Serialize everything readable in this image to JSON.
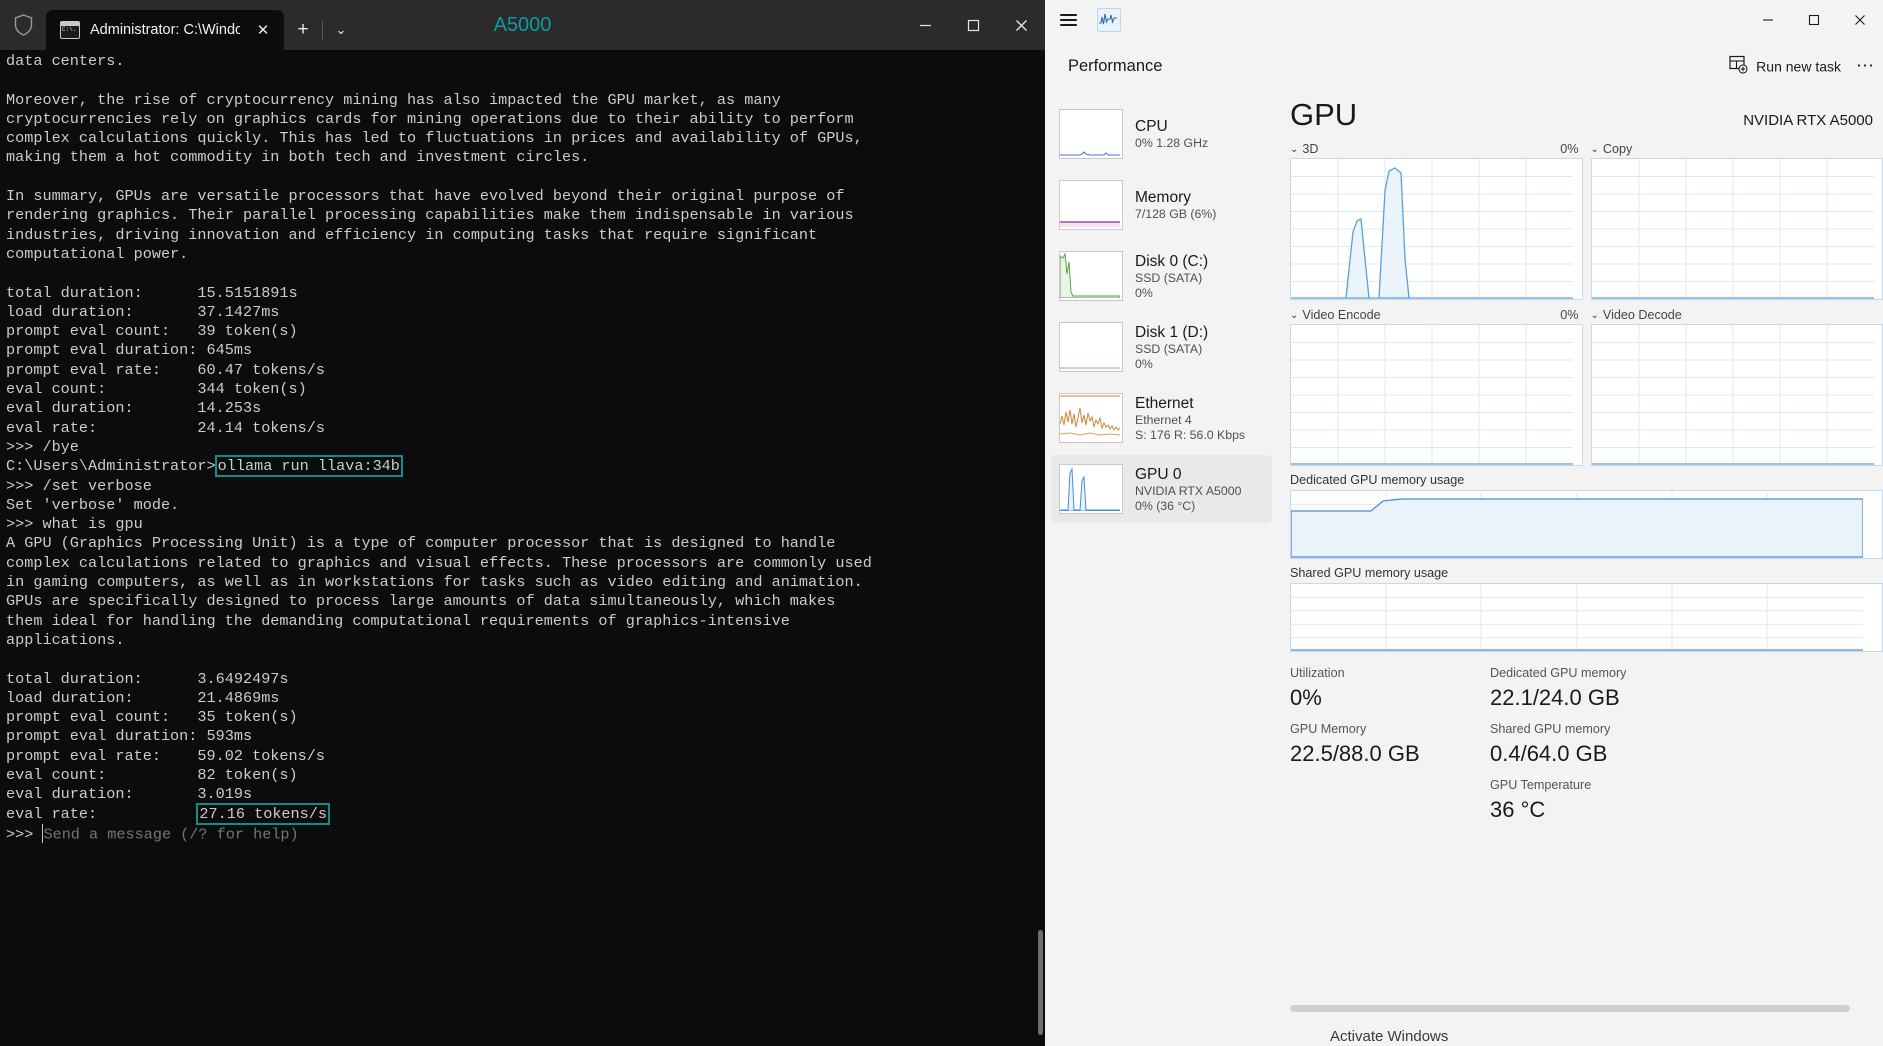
{
  "terminal": {
    "window_title": "A5000",
    "window_title_color": "#0c9ba6",
    "tab_title": "Administrator: C:\\Windows\\sy",
    "tab_close_label": "✕",
    "new_tab_label": "+",
    "tab_dropdown_label": "⌄",
    "minimize_label": "–",
    "maximize_label": "□",
    "close_label": "✕",
    "highlight_color": "#128c8c",
    "lines_1": "data centers.\n\nMoreover, the rise of cryptocurrency mining has also impacted the GPU market, as many\ncryptocurrencies rely on graphics cards for mining operations due to their ability to perform\ncomplex calculations quickly. This has led to fluctuations in prices and availability of GPUs,\nmaking them a hot commodity in both tech and investment circles.\n\nIn summary, GPUs are versatile processors that have evolved beyond their original purpose of\nrendering graphics. Their parallel processing capabilities make them indispensable in various\nindustries, driving innovation and efficiency in computing tasks that require significant\ncomputational power.\n\ntotal duration:      15.5151891s\nload duration:       37.1427ms\nprompt eval count:   39 token(s)\nprompt eval duration: 645ms\nprompt eval rate:    60.47 tokens/s\neval count:          344 token(s)\neval duration:       14.253s\neval rate:           24.14 tokens/s\n>>> /bye\n",
    "prompt_path": "C:\\Users\\Administrator>",
    "highlighted_command": "ollama run llava:34b",
    "lines_2": "\n>>> /set verbose\nSet 'verbose' mode.\n>>> what is gpu\nA GPU (Graphics Processing Unit) is a type of computer processor that is designed to handle\ncomplex calculations related to graphics and visual effects. These processors are commonly used\nin gaming computers, as well as in workstations for tasks such as video editing and animation.\nGPUs are specifically designed to process large amounts of data simultaneously, which makes\nthem ideal for handling the demanding computational requirements of graphics-intensive\napplications.\n\ntotal duration:      3.6492497s\nload duration:       21.4869ms\nprompt eval count:   35 token(s)\nprompt eval duration: 593ms\nprompt eval rate:    59.02 tokens/s\neval count:          82 token(s)\neval duration:       3.019s\n",
    "eval_rate_label": "eval rate:           ",
    "highlighted_eval_rate": "27.16 tokens/s",
    "final_prompt": ">>> ",
    "final_prompt_placeholder": "Send a message (/? for help)"
  },
  "taskmgr": {
    "minimize_label": "–",
    "maximize_label": "□",
    "close_label": "✕",
    "page_title": "Performance",
    "run_new_task": "Run new task",
    "more_label": "⋯",
    "sidebar": [
      {
        "name": "CPU",
        "sub1": "0%  1.28 GHz",
        "sub2": "",
        "accent": "#4a79c9",
        "selected": false
      },
      {
        "name": "Memory",
        "sub1": "7/128 GB (6%)",
        "sub2": "",
        "accent": "#a349a4",
        "selected": false
      },
      {
        "name": "Disk 0 (C:)",
        "sub1": "SSD (SATA)",
        "sub2": "0%",
        "accent": "#56a64b",
        "selected": false
      },
      {
        "name": "Disk 1 (D:)",
        "sub1": "SSD (SATA)",
        "sub2": "0%",
        "accent": "#56a64b",
        "selected": false
      },
      {
        "name": "Ethernet",
        "sub1": "Ethernet 4",
        "sub2": "S: 176 R: 56.0 Kbps",
        "accent": "#c98a3a",
        "selected": false
      },
      {
        "name": "GPU 0",
        "sub1": "NVIDIA RTX A5000",
        "sub2": "0%  (36 °C)",
        "accent": "#4a8fd4",
        "selected": true
      }
    ],
    "gpu": {
      "title": "GPU",
      "model": "NVIDIA RTX A5000",
      "graphs": [
        {
          "label": "3D",
          "pct": "0%"
        },
        {
          "label": "Copy",
          "pct": ""
        },
        {
          "label": "Video Encode",
          "pct": "0%"
        },
        {
          "label": "Video Decode",
          "pct": ""
        }
      ],
      "dedicated_label": "Dedicated GPU memory usage",
      "shared_label": "Shared GPU memory usage",
      "stats": [
        {
          "label": "Utilization",
          "value": "0%"
        },
        {
          "label": "Dedicated GPU memory",
          "value": "22.1/24.0 GB"
        },
        {
          "label": "GPU Memory",
          "value": "22.5/88.0 GB"
        },
        {
          "label": "Shared GPU memory",
          "value": "0.4/64.0 GB"
        },
        {
          "label": "GPU Temperature",
          "value": "36 °C"
        }
      ]
    },
    "watermark": "Activate Windows"
  }
}
